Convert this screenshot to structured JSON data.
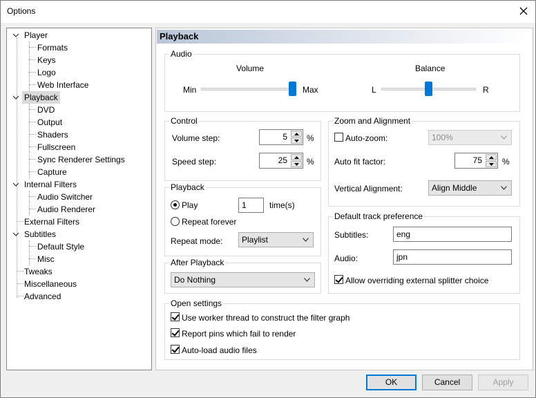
{
  "window": {
    "title": "Options"
  },
  "tree": {
    "items": [
      {
        "label": "Player",
        "expanded": true
      },
      {
        "label": "Formats"
      },
      {
        "label": "Keys"
      },
      {
        "label": "Logo"
      },
      {
        "label": "Web Interface"
      },
      {
        "label": "Playback",
        "expanded": true,
        "selected": true
      },
      {
        "label": "DVD"
      },
      {
        "label": "Output"
      },
      {
        "label": "Shaders"
      },
      {
        "label": "Fullscreen"
      },
      {
        "label": "Sync Renderer Settings"
      },
      {
        "label": "Capture"
      },
      {
        "label": "Internal Filters",
        "expanded": true
      },
      {
        "label": "Audio Switcher"
      },
      {
        "label": "Audio Renderer"
      },
      {
        "label": "External Filters"
      },
      {
        "label": "Subtitles",
        "expanded": true
      },
      {
        "label": "Default Style"
      },
      {
        "label": "Misc"
      },
      {
        "label": "Tweaks"
      },
      {
        "label": "Miscellaneous"
      },
      {
        "label": "Advanced"
      }
    ]
  },
  "page": {
    "title": "Playback"
  },
  "audio": {
    "group_label": "Audio",
    "volume": {
      "label": "Volume",
      "min_label": "Min",
      "max_label": "Max",
      "level": 0.97
    },
    "balance": {
      "label": "Balance",
      "left_label": "L",
      "right_label": "R",
      "level": 0.5
    }
  },
  "control": {
    "group_label": "Control",
    "volume_step": {
      "label": "Volume step:",
      "value": "5",
      "unit": "%"
    },
    "speed_step": {
      "label": "Speed step:",
      "value": "25",
      "unit": "%"
    }
  },
  "playback": {
    "group_label": "Playback",
    "play_label": "Play",
    "play_times_value": "1",
    "times_label": "time(s)",
    "repeat_forever_label": "Repeat forever",
    "repeat_mode_label": "Repeat mode:",
    "repeat_mode_value": "Playlist"
  },
  "after_playback": {
    "group_label": "After Playback",
    "value": "Do Nothing"
  },
  "zoom": {
    "group_label": "Zoom and Alignment",
    "auto_zoom_label": "Auto-zoom:",
    "auto_zoom_value": "100%",
    "auto_fit_label": "Auto fit factor:",
    "auto_fit_value": "75",
    "auto_fit_unit": "%",
    "vertical_alignment_label": "Vertical Alignment:",
    "vertical_alignment_value": "Align Middle"
  },
  "track_pref": {
    "group_label": "Default track preference",
    "subtitles_label": "Subtitles:",
    "subtitles_value": "eng",
    "audio_label": "Audio:",
    "audio_value": "jpn",
    "override_label": "Allow overriding external splitter choice"
  },
  "open_settings": {
    "group_label": "Open settings",
    "worker_thread_label": "Use worker thread to construct the filter graph",
    "report_pins_label": "Report pins which fail to render",
    "autoload_audio_label": "Auto-load audio files"
  },
  "buttons": {
    "ok": "OK",
    "cancel": "Cancel",
    "apply": "Apply"
  },
  "colors": {
    "accent": "#0078d7",
    "header_gradient_start": "#b9c6d8",
    "selection": "#dadada"
  }
}
